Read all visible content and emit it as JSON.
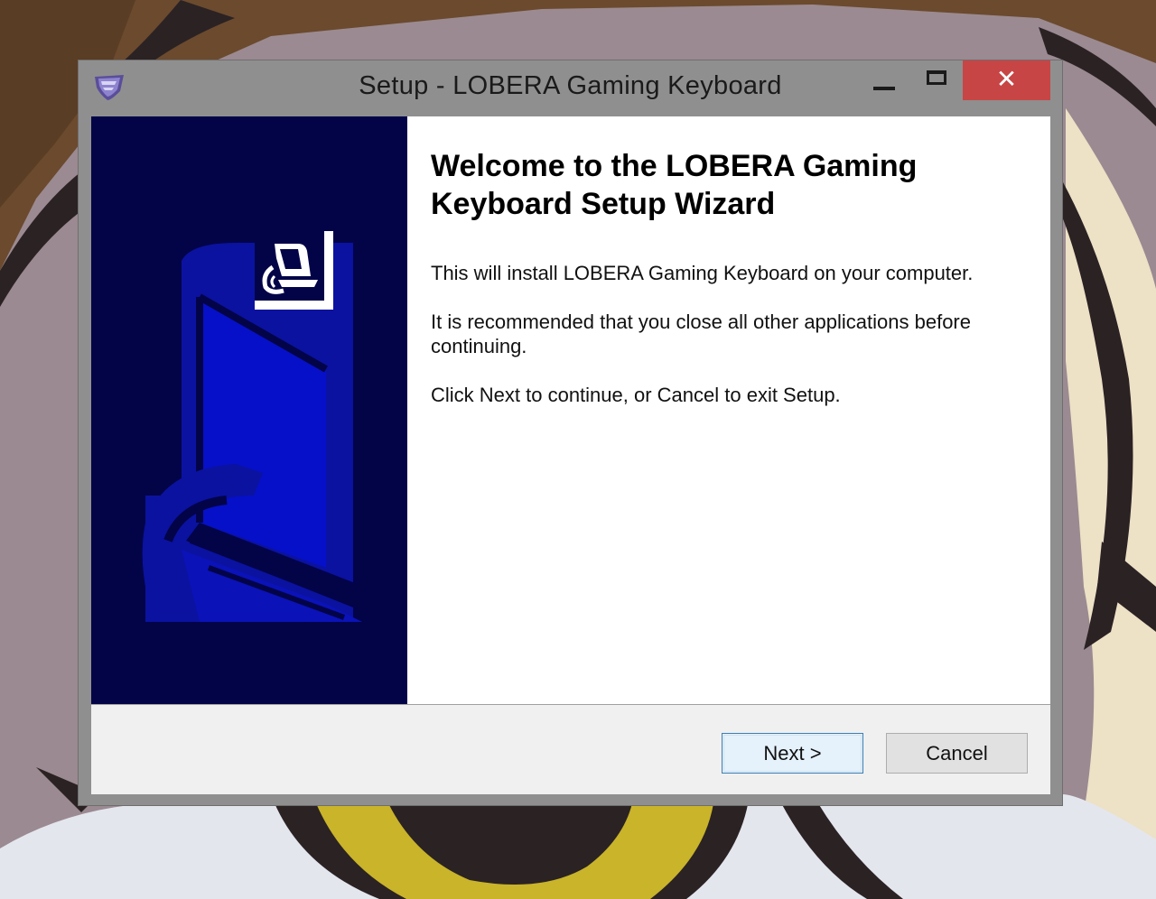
{
  "window": {
    "title": "Setup - LOBERA Gaming Keyboard",
    "icons": {
      "app": "setup-shield-icon",
      "minimize": "minimize-icon",
      "maximize": "maximize-icon",
      "close": "close-icon"
    },
    "close_glyph": "✕"
  },
  "wizard": {
    "heading": "Welcome to the LOBERA Gaming Keyboard Setup Wizard",
    "paragraphs": {
      "install": "This will install LOBERA Gaming Keyboard on your computer.",
      "recommend": "It is recommended that you close all other applications before continuing.",
      "click": "Click Next to continue, or Cancel to exit Setup."
    },
    "side_image_icon": "computer-install-icon"
  },
  "buttons": {
    "next_label": "Next >",
    "cancel_label": "Cancel"
  },
  "colors": {
    "side_panel": "#030448",
    "side_art": "#0b12a0",
    "close_button": "#c74545",
    "next_border": "#3c7fb1"
  }
}
